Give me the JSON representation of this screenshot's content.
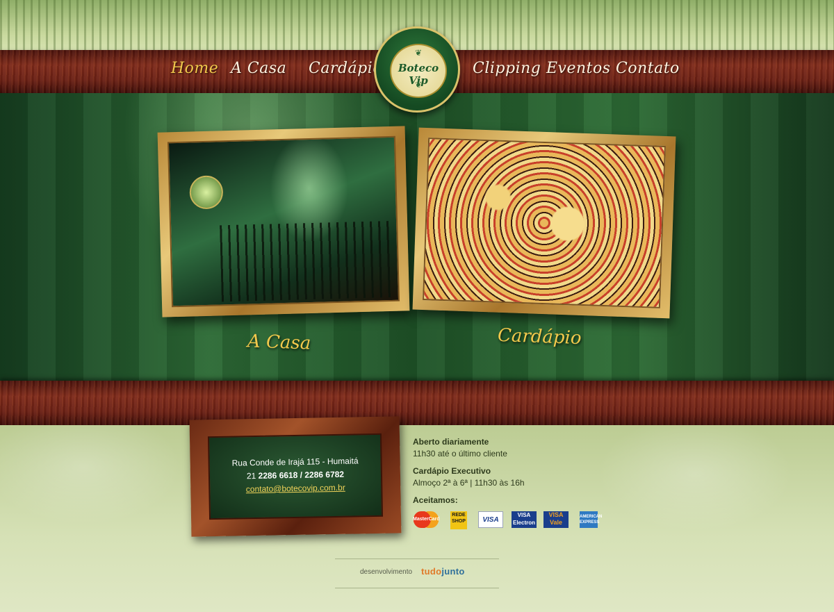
{
  "brand": {
    "name": "Boteco Vip"
  },
  "nav": {
    "items": [
      {
        "label": "Home",
        "active": true
      },
      {
        "label": "A Casa"
      },
      {
        "label": "Cardápio"
      },
      {
        "label": "Clipping"
      },
      {
        "label": "Eventos"
      },
      {
        "label": "Contato"
      }
    ]
  },
  "gallery": {
    "casa_caption": "A Casa",
    "cardapio_caption": "Cardápio"
  },
  "contact": {
    "address": "Rua Conde de Irajá 115 - Humaitá",
    "area_code": "21",
    "phones": "2286 6618 / 2286 6782",
    "email": "contato@botecovip.com.br"
  },
  "info": {
    "hours_title": "Aberto diariamente",
    "hours_text": "11h30 até o último cliente",
    "exec_title": "Cardápio Executivo",
    "exec_text": "Almoço 2ª à 6ª | 11h30 às 16h",
    "payment_title": "Aceitamos:"
  },
  "payment_cards": [
    {
      "name": "MasterCard",
      "color": "#e8381c"
    },
    {
      "name": "REDE SHOP",
      "color": "#f1c414"
    },
    {
      "name": "VISA",
      "color": "#1a3e8c"
    },
    {
      "name": "VISA Electron",
      "color": "#1a3e8c"
    },
    {
      "name": "VISA Vale",
      "color": "#f0a020"
    },
    {
      "name": "American Express",
      "color": "#2f79c2"
    }
  ],
  "credits": {
    "label": "desenvolvimento",
    "logo_part1": "tudo",
    "logo_part2": "junto"
  }
}
